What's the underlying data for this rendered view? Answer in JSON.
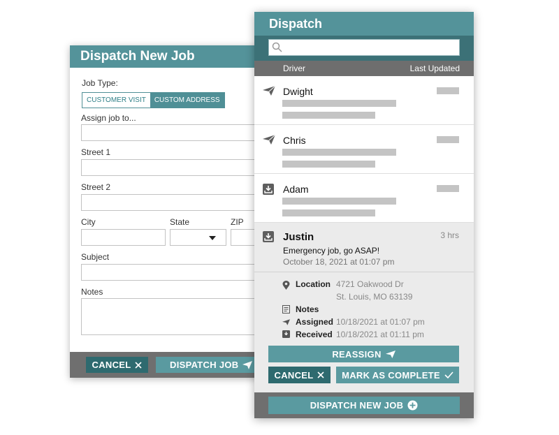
{
  "new_job": {
    "title": "Dispatch New Job",
    "job_type_label": "Job Type:",
    "job_type_options": [
      "CUSTOMER VISIT",
      "CUSTOM ADDRESS"
    ],
    "assign_label": "Assign job to...",
    "street1_label": "Street 1",
    "street2_label": "Street 2",
    "city_label": "City",
    "state_label": "State",
    "zip_label": "ZIP",
    "subject_label": "Subject",
    "notes_label": "Notes",
    "cancel_label": "CANCEL",
    "dispatch_label": "DISPATCH JOB"
  },
  "dispatch": {
    "title": "Dispatch",
    "search": {
      "placeholder": "",
      "value": ""
    },
    "columns": {
      "driver": "Driver",
      "last_updated": "Last Updated"
    },
    "drivers": [
      {
        "name": "Dwight",
        "status_icon": "paper-plane-icon"
      },
      {
        "name": "Chris",
        "status_icon": "paper-plane-icon"
      },
      {
        "name": "Adam",
        "status_icon": "inbox-download-icon"
      }
    ],
    "selected": {
      "name": "Justin",
      "status_icon": "inbox-download-icon",
      "time": "3 hrs",
      "message": "Emergency job, go ASAP!",
      "date": "October 18, 2021 at 01:07 pm",
      "location_label": "Location",
      "location_line1": "4721 Oakwood Dr",
      "location_line2": "St. Louis, MO 63139",
      "notes_label": "Notes",
      "assigned_label": "Assigned",
      "assigned_value": "10/18/2021 at 01:07 pm",
      "received_label": "Received",
      "received_value": "10/18/2021 at 01:11 pm",
      "reassign_label": "REASSIGN",
      "cancel_label": "CANCEL",
      "complete_label": "MARK AS COMPLETE"
    },
    "new_job_label": "DISPATCH NEW JOB"
  },
  "colors": {
    "header_teal": "#54939a",
    "dark_teal": "#2e6a6f",
    "button_teal": "#5a9aa0",
    "footer_gray": "#6f6f6f"
  }
}
